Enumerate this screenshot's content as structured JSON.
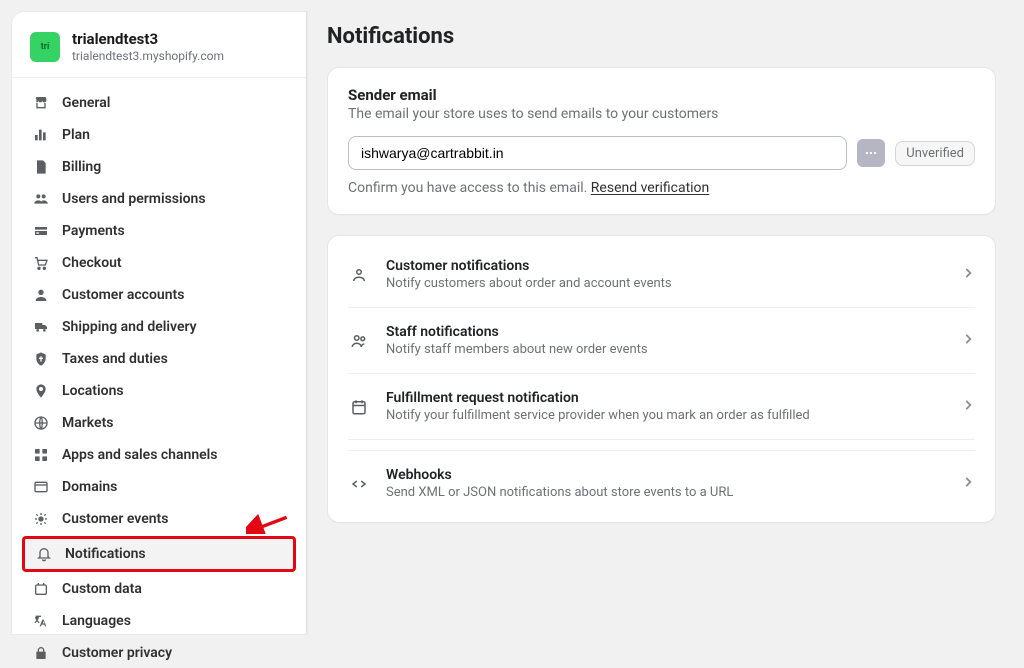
{
  "store": {
    "icon_label": "tri",
    "name": "trialendtest3",
    "domain": "trialendtest3.myshopify.com"
  },
  "sidebar": {
    "items": [
      {
        "label": "General",
        "icon": "store"
      },
      {
        "label": "Plan",
        "icon": "plan"
      },
      {
        "label": "Billing",
        "icon": "billing"
      },
      {
        "label": "Users and permissions",
        "icon": "users"
      },
      {
        "label": "Payments",
        "icon": "payments"
      },
      {
        "label": "Checkout",
        "icon": "checkout"
      },
      {
        "label": "Customer accounts",
        "icon": "cust_acc"
      },
      {
        "label": "Shipping and delivery",
        "icon": "shipping"
      },
      {
        "label": "Taxes and duties",
        "icon": "taxes"
      },
      {
        "label": "Locations",
        "icon": "locations"
      },
      {
        "label": "Markets",
        "icon": "markets"
      },
      {
        "label": "Apps and sales channels",
        "icon": "apps"
      },
      {
        "label": "Domains",
        "icon": "domains"
      },
      {
        "label": "Customer events",
        "icon": "events"
      },
      {
        "label": "Notifications",
        "icon": "bell",
        "active": true,
        "highlighted": true
      },
      {
        "label": "Custom data",
        "icon": "custom"
      },
      {
        "label": "Languages",
        "icon": "lang"
      },
      {
        "label": "Customer privacy",
        "icon": "lock"
      }
    ]
  },
  "page": {
    "title": "Notifications"
  },
  "sender_email": {
    "title": "Sender email",
    "subtitle": "The email your store uses to send emails to your customers",
    "value": "ishwarya@cartrabbit.in",
    "badge": "Unverified",
    "confirm_prefix": "Confirm you have access to this email. ",
    "resend_link": "Resend verification"
  },
  "sections": [
    {
      "title": "Customer notifications",
      "sub": "Notify customers about order and account events",
      "icon": "person"
    },
    {
      "title": "Staff notifications",
      "sub": "Notify staff members about new order events",
      "icon": "staff"
    },
    {
      "title": "Fulfillment request notification",
      "sub": "Notify your fulfillment service provider when you mark an order as fulfilled",
      "icon": "fulfillment"
    },
    {
      "title": "Webhooks",
      "sub": "Send XML or JSON notifications about store events to a URL",
      "icon": "code"
    }
  ]
}
